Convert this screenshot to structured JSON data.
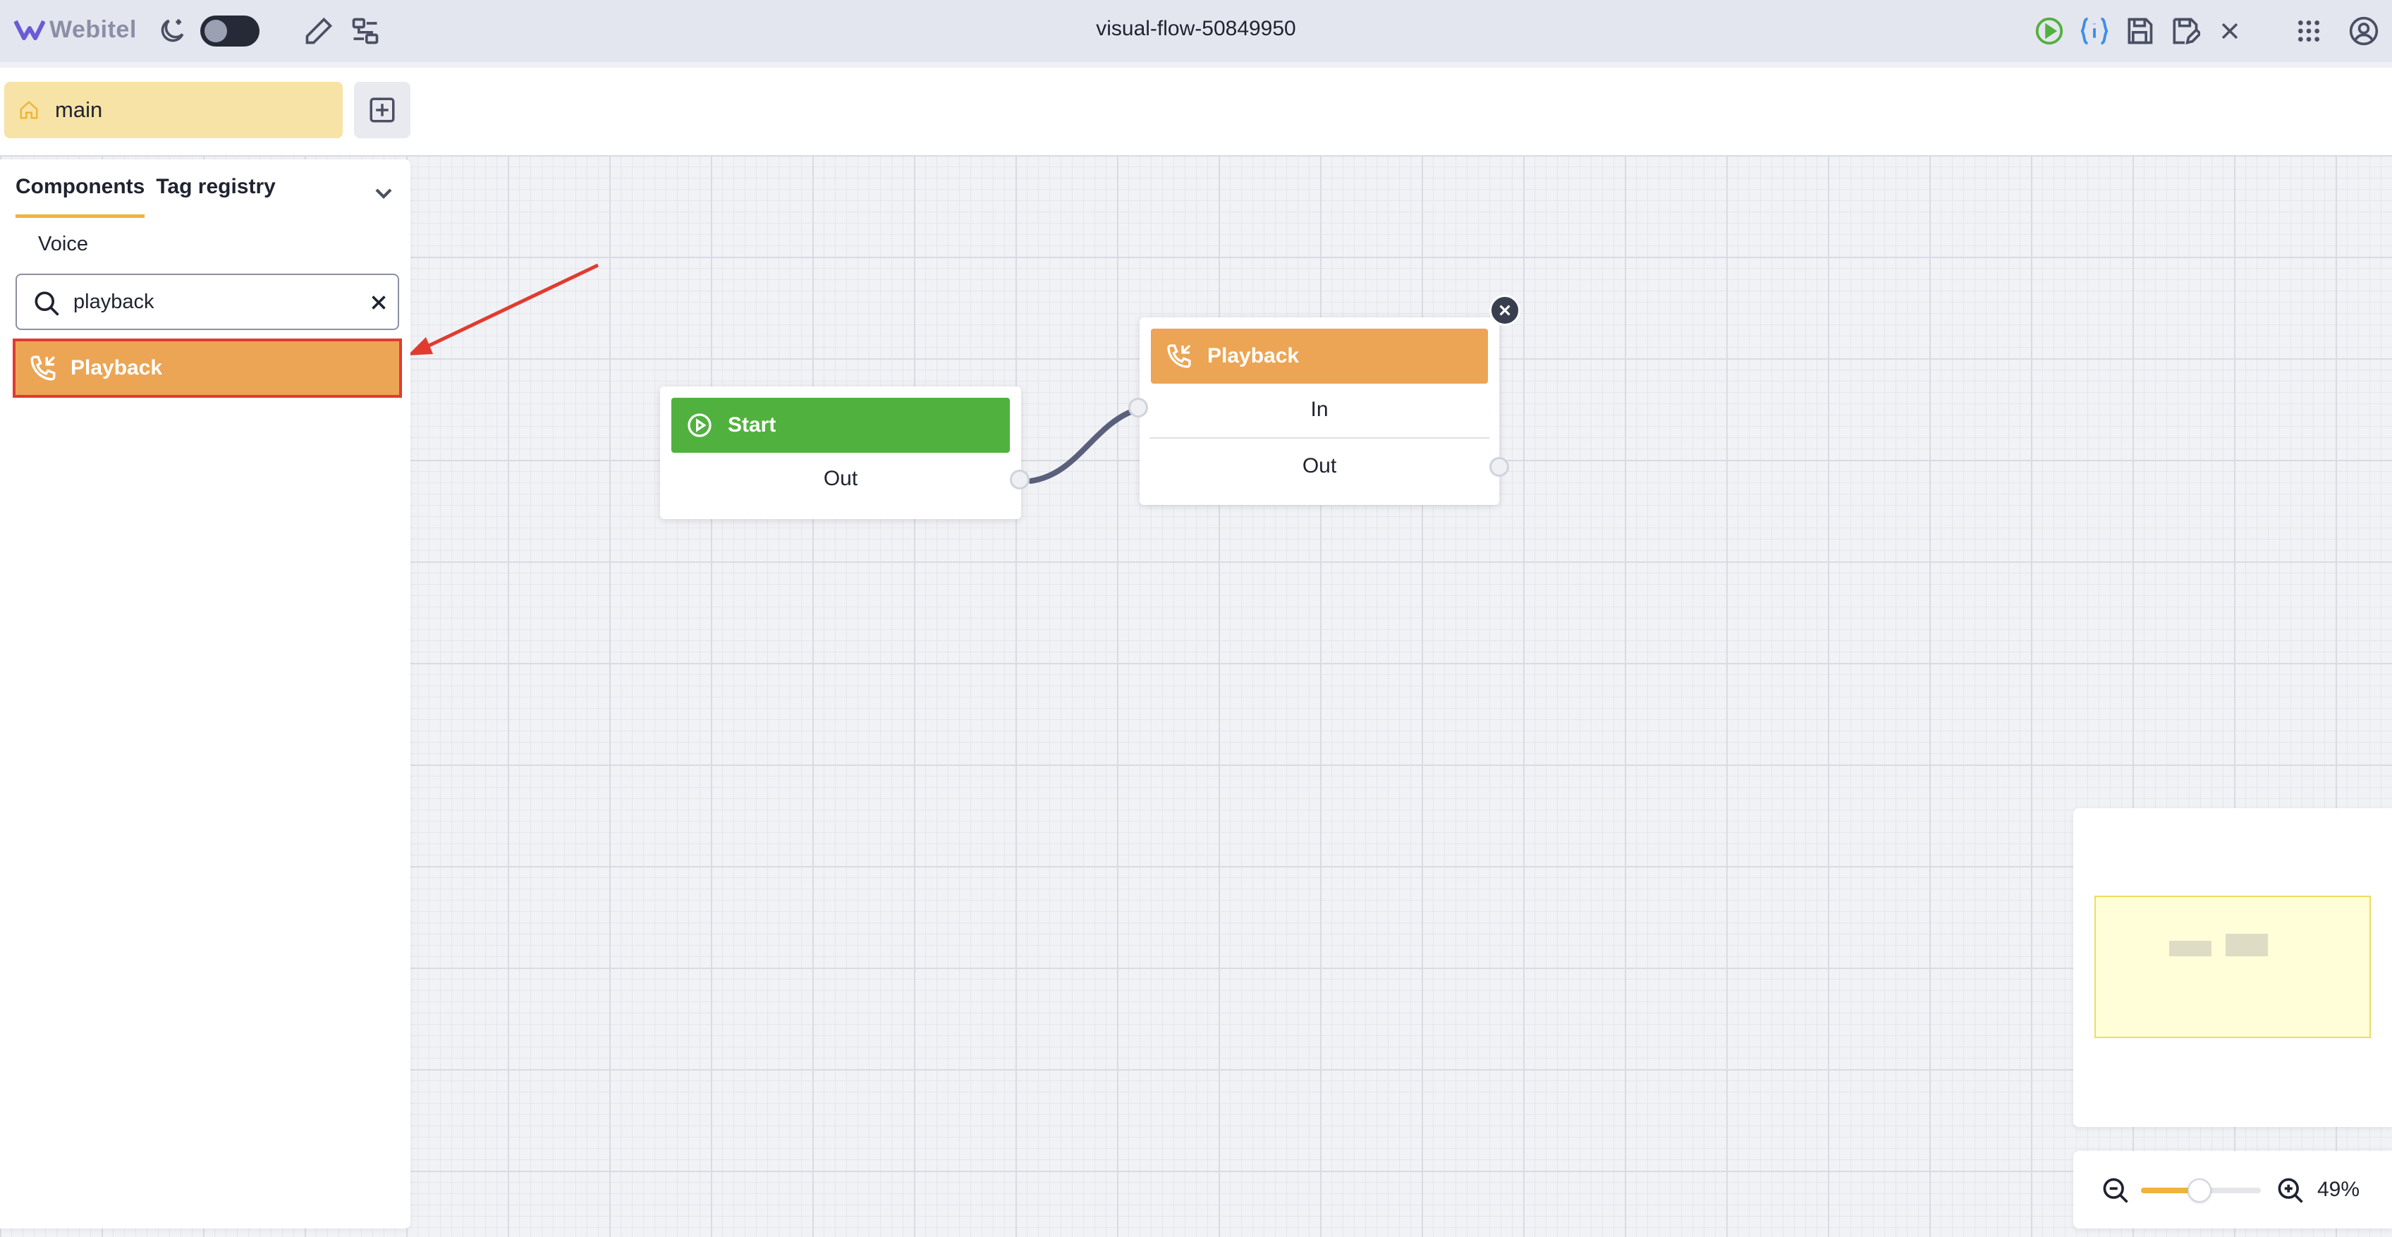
{
  "app": {
    "logo_text": "Webitel"
  },
  "header": {
    "title": "visual-flow-50849950"
  },
  "tabs": [
    {
      "label": "main",
      "icon": "home-icon"
    }
  ],
  "panel": {
    "tabs": [
      {
        "label": "Components",
        "active": true
      },
      {
        "label": "Tag registry",
        "active": false
      }
    ],
    "category": "Voice",
    "search": {
      "value": "playback",
      "placeholder": ""
    },
    "results": [
      {
        "label": "Playback",
        "icon": "phone-incoming-icon"
      }
    ]
  },
  "nodes": {
    "start": {
      "title": "Start",
      "out_label": "Out",
      "color": "#51b13e"
    },
    "playback": {
      "title": "Playback",
      "in_label": "In",
      "out_label": "Out",
      "color": "#eba554"
    }
  },
  "zoom": {
    "label": "49%",
    "value": 0.49
  },
  "colors": {
    "accent": "#f0b43c",
    "highlight_border": "#e13b2f",
    "annotation_arrow": "#e13b2f",
    "connection": "#5a607a"
  }
}
